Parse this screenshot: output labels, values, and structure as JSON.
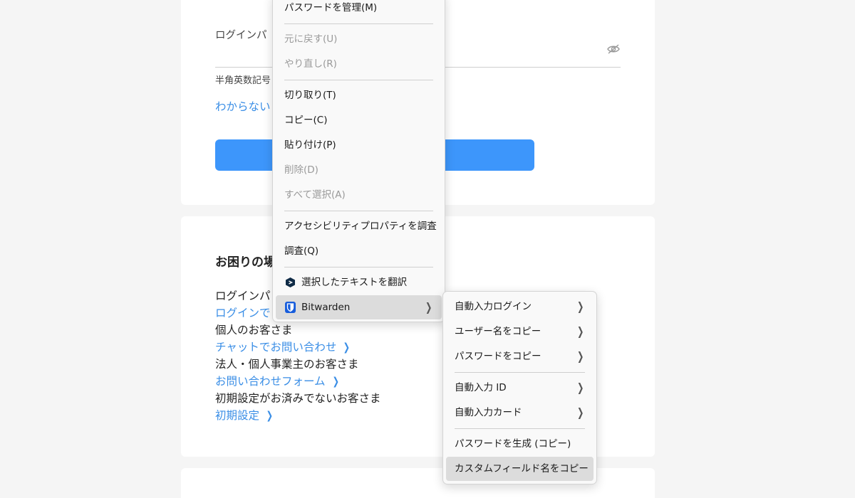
{
  "login": {
    "password_label": "ログインパ",
    "hint": "半角英数記号",
    "forgot_link": "わからない"
  },
  "help": {
    "title": "お困りの場",
    "lines": [
      {
        "text": "ログインパ",
        "type": "text"
      },
      {
        "text": "ログインで",
        "type": "link"
      },
      {
        "text": "個人のお客さま",
        "type": "text"
      },
      {
        "text": "チャットでお問い合わせ",
        "type": "link"
      },
      {
        "text": "法人・個人事業主のお客さま",
        "type": "text"
      },
      {
        "text": "お問い合わせフォーム",
        "type": "link"
      },
      {
        "text": "初期設定がお済みでないお客さま",
        "type": "text"
      },
      {
        "text": "初期設定",
        "type": "link"
      }
    ]
  },
  "context_menu": {
    "items": {
      "manage_passwords": "パスワードを管理(M)",
      "undo": "元に戻す(U)",
      "redo": "やり直し(R)",
      "cut": "切り取り(T)",
      "copy": "コピー(C)",
      "paste": "貼り付け(P)",
      "delete": "削除(D)",
      "select_all": "すべて選択(A)",
      "inspect_accessibility": "アクセシビリティプロパティを調査",
      "inspect": "調査(Q)",
      "translate": "選択したテキストを翻訳",
      "bitwarden": "Bitwarden"
    }
  },
  "bitwarden_submenu": {
    "autofill_login": "自動入力ログイン",
    "copy_username": "ユーザー名をコピー",
    "copy_password": "パスワードをコピー",
    "autofill_identity": "自動入力 ID",
    "autofill_card": "自動入力カード",
    "generate_password": "パスワードを生成 (コピー)",
    "copy_custom_field": "カスタムフィールド名をコピー"
  },
  "colors": {
    "link": "#3a8ee6",
    "button": "#3d96fb",
    "bitwarden": "#175ddc"
  }
}
